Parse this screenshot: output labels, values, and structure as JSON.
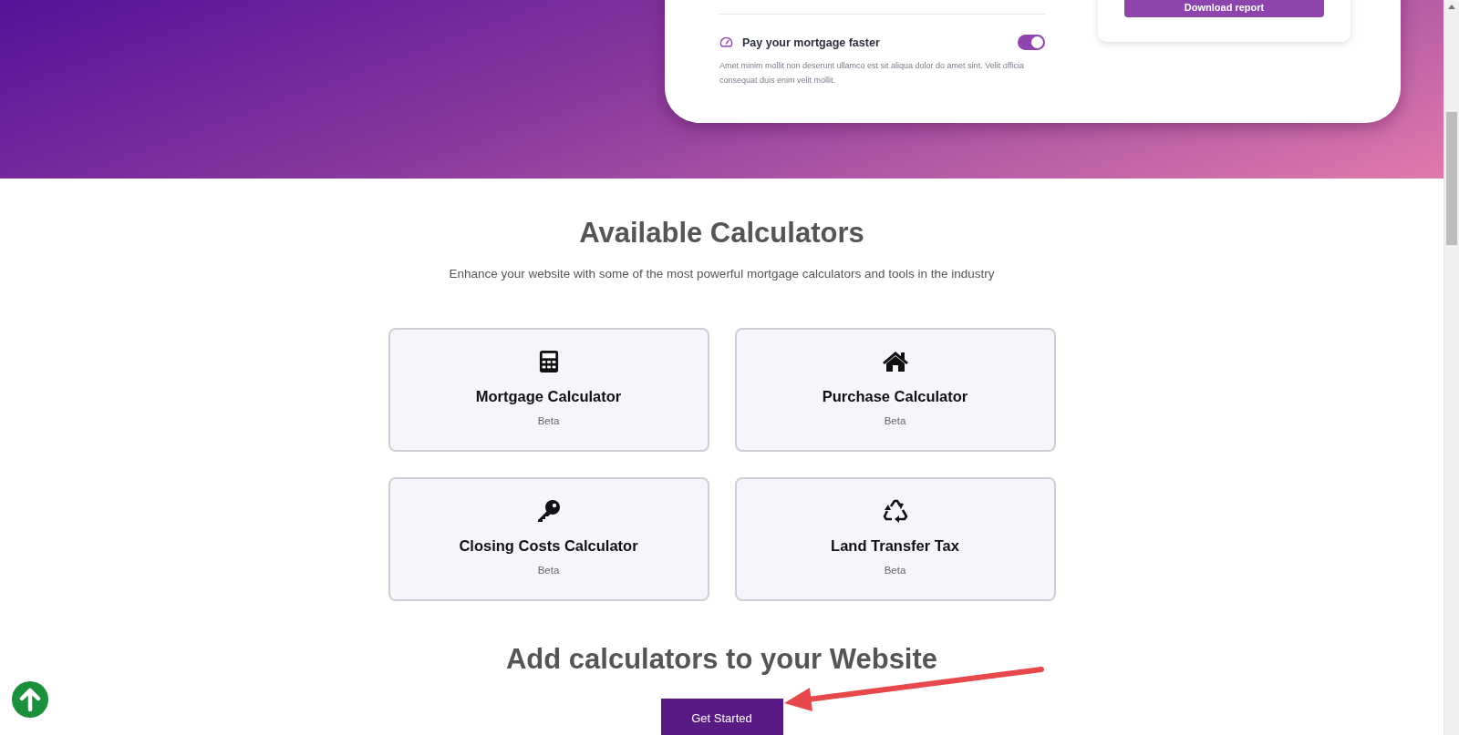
{
  "feature": {
    "title": "Pay your mortgage faster",
    "on": true,
    "description": "Amet minim mollit non deserunt ullamco est sit aliqua dolor do amet sint. Velit officia consequat duis enim velit mollit."
  },
  "report_button": "Download report",
  "section": {
    "title": "Available Calculators",
    "subtitle": "Enhance your website with some of the most powerful mortgage calculators and tools in the industry"
  },
  "calculators": [
    {
      "name": "Mortgage Calculator",
      "badge": "Beta"
    },
    {
      "name": "Purchase Calculator",
      "badge": "Beta"
    },
    {
      "name": "Closing Costs Calculator",
      "badge": "Beta"
    },
    {
      "name": "Land Transfer Tax",
      "badge": "Beta"
    }
  ],
  "cta": {
    "title": "Add calculators to your Website",
    "button": "Get Started"
  }
}
